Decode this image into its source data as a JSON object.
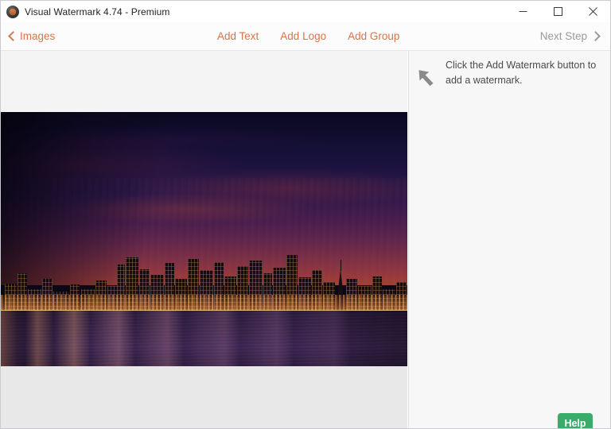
{
  "window": {
    "title": "Visual Watermark 4.74 - Premium",
    "app_icon": "padlock-app-icon",
    "minimize_label": "–",
    "maximize_label": "□",
    "close_label": "✕"
  },
  "toolbar": {
    "back_label": "Images",
    "back_icon": "chevron-left-icon",
    "items": [
      {
        "label": "Add Text"
      },
      {
        "label": "Add Logo"
      },
      {
        "label": "Add Group"
      }
    ],
    "next_label": "Next Step",
    "next_icon": "chevron-right-icon",
    "accent_color": "#d9734a",
    "disabled_color": "#9a9a9a"
  },
  "hint_panel": {
    "arrow_icon": "arrow-up-left-icon",
    "text": "Click the Add Watermark button to add a watermark."
  },
  "canvas": {
    "background_color": "#e8e8e8",
    "top_fill_color": "#f4f4f4",
    "photo_alt": "San Francisco skyline at dusk over the bay"
  },
  "help": {
    "label": "Help",
    "color": "#3aab6b"
  }
}
